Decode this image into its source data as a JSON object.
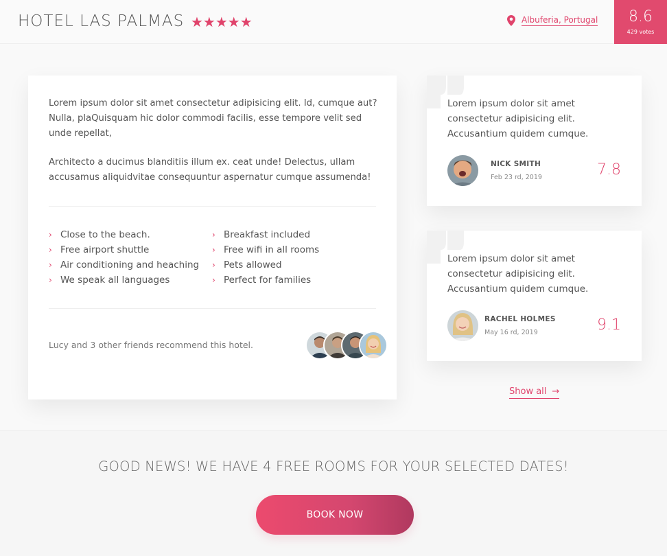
{
  "header": {
    "hotel_name": "HOTEL LAS PALMAS",
    "stars": "★★★★★",
    "star_count": 5,
    "location": "Albuferia, Portugal",
    "score": "8.6",
    "votes": "429 votes"
  },
  "main": {
    "paragraphs": [
      "Lorem ipsum dolor sit amet consectetur adipisicing elit. Id, cumque aut? Nulla, plaQuisquam hic dolor commodi facilis, esse tempore velit sed unde repellat,",
      "Architecto a ducimus blanditiis illum ex. ceat unde! Delectus, ullam accusamus aliquidvitae consequuntur aspernatur cumque assumenda!"
    ],
    "features_col1": [
      "Close to the beach.",
      "Free airport shuttle",
      "Air conditioning and heaching",
      "We speak all languages"
    ],
    "features_col2": [
      "Breakfast included",
      "Free wifi in all rooms",
      "Pets allowed",
      "Perfect for families"
    ],
    "friends_text": "Lucy and 3 other friends recommend this hotel."
  },
  "reviews": [
    {
      "text": "Lorem ipsum dolor sit amet consectetur adipisicing elit. Accusantium quidem cumque.",
      "name": "NICK SMITH",
      "date": "Feb 23 rd, 2019",
      "score": "7.8"
    },
    {
      "text": "Lorem ipsum dolor sit amet consectetur adipisicing elit. Accusantium quidem cumque.",
      "name": "RACHEL HOLMES",
      "date": "May 16 rd, 2019",
      "score": "9.1"
    }
  ],
  "show_all": "Show all",
  "bottom": {
    "message": "GOOD NEWS! WE HAVE 4 FREE ROOMS FOR YOUR SELECTED DATES!",
    "book_label": "BOOK NOW"
  },
  "colors": {
    "accent": "#e0436b",
    "score_bg": "#e14a6e"
  }
}
